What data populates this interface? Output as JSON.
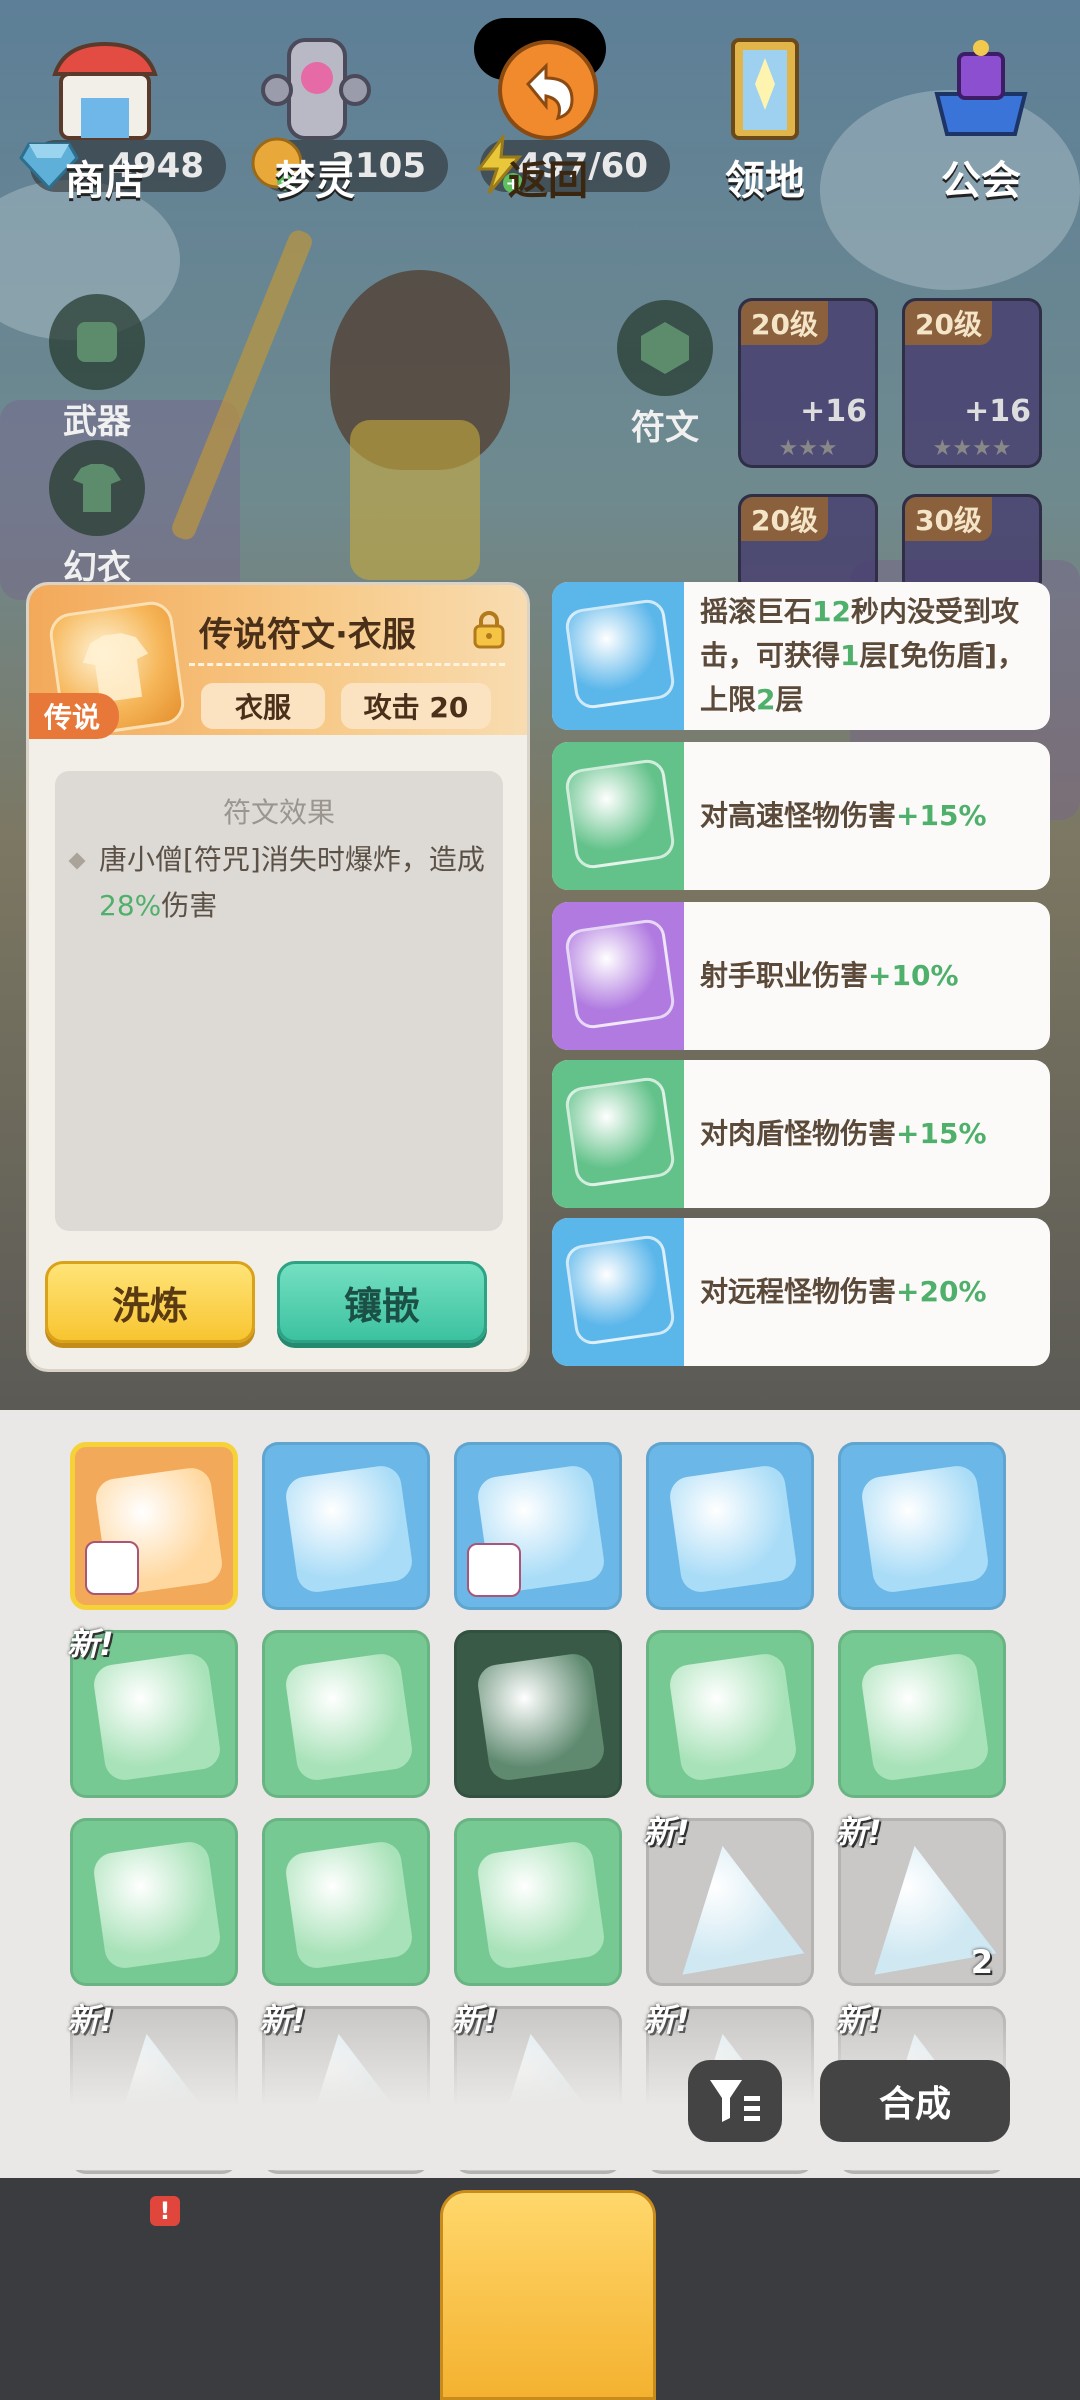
{
  "resources": {
    "gems": "4948",
    "coins": "2105",
    "energy": "497/60"
  },
  "character": {
    "slot_weapon": "武器",
    "slot_fashion": "幻衣",
    "slot_rune": "符文",
    "equipment": [
      {
        "level": "20级",
        "plus": "+16"
      },
      {
        "level": "20级",
        "plus": "+16"
      },
      {
        "level": "20级",
        "plus": ""
      },
      {
        "level": "30级",
        "plus": ""
      }
    ]
  },
  "detail": {
    "title": "传说符文·衣服",
    "rarity_tag": "传说",
    "type_pill": "衣服",
    "stat_pill": "攻击 20",
    "effect_heading": "符文效果",
    "effect_text_a": "唐小僧[符咒]消失时爆炸，造成",
    "effect_value": "28%",
    "effect_text_b": "伤害",
    "refine_button": "洗炼",
    "inlay_button": "镶嵌"
  },
  "attributes": [
    {
      "color": "#5bb6ea",
      "parts": [
        [
          "摇滚巨石",
          false
        ],
        [
          "12",
          true
        ],
        [
          "秒内没受到攻击，可获得",
          false
        ],
        [
          "1",
          true
        ],
        [
          "层[免伤盾]，上限",
          false
        ],
        [
          "2",
          true
        ],
        [
          "层",
          false
        ]
      ]
    },
    {
      "color": "#63c28a",
      "parts": [
        [
          "对高速怪物伤害",
          false
        ],
        [
          "+15%",
          true
        ]
      ]
    },
    {
      "color": "#b07ae0",
      "parts": [
        [
          "射手职业伤害",
          false
        ],
        [
          "+10%",
          true
        ]
      ]
    },
    {
      "color": "#63c28a",
      "parts": [
        [
          "对肉盾怪物伤害",
          false
        ],
        [
          "+15%",
          true
        ]
      ]
    },
    {
      "color": "#5bb6ea",
      "parts": [
        [
          "对远程怪物伤害",
          false
        ],
        [
          "+20%",
          true
        ]
      ]
    }
  ],
  "inventory": {
    "new_badge": "新!",
    "count_label": "2",
    "merge_button": "合成"
  },
  "nav": {
    "shop": "商店",
    "spirit": "梦灵",
    "back": "返回",
    "territory": "领地",
    "guild": "公会",
    "alert": "!"
  },
  "colors": {
    "legend": "#f3a95a",
    "blue": "#5bb6ea",
    "green": "#63c28a",
    "purple": "#b07ae0",
    "highlight_value": "#4fb06b"
  }
}
